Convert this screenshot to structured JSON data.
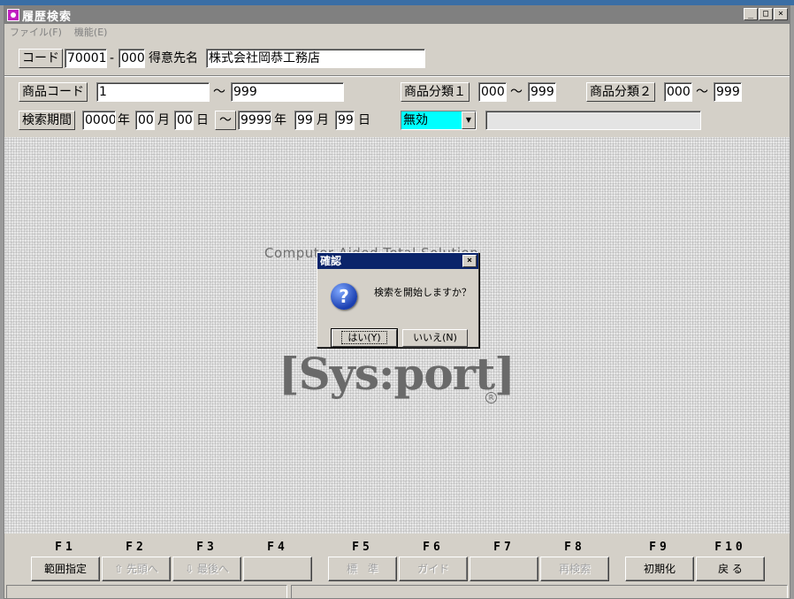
{
  "window": {
    "title": "履歴検索",
    "min_label": "_",
    "max_label": "□",
    "close_label": "×"
  },
  "menu": [
    {
      "label": "ファイル(F)"
    },
    {
      "label": "機能(E)"
    }
  ],
  "row1": {
    "code_label": "コード",
    "code_value": "70001",
    "dash": "-",
    "branch_value": "000",
    "customer_label": "得意先名",
    "customer_value": "株式会社岡恭工務店"
  },
  "row2": {
    "product_code_label": "商品コード",
    "product_code_from": "1",
    "tilde": "～",
    "product_code_to": "999",
    "category1_label": "商品分類１",
    "category1_from": "000",
    "category1_to": "999",
    "category2_label": "商品分類２",
    "category2_from": "000",
    "category2_to": "999"
  },
  "row3": {
    "period_label": "検索期間",
    "from_year": "0000",
    "year_unit": "年",
    "from_month": "00",
    "month_unit": "月",
    "from_day": "00",
    "day_unit": "日",
    "tilde_button": "～",
    "to_year": "9999",
    "to_month": "99",
    "to_day": "99",
    "validity_value": "無効",
    "dropdown_arrow": "▼",
    "extra_value": ""
  },
  "logo": {
    "subtitle": "Computer Aided Total Solution",
    "name": "[Sys:port]",
    "reg": "R"
  },
  "dialog": {
    "title": "確認",
    "close": "×",
    "icon": "?",
    "message": "検索を開始しますか？",
    "yes": "はい(Y)",
    "no": "いいえ(N)"
  },
  "fkeys": [
    {
      "key": "F1",
      "label": "範囲指定",
      "enabled": true
    },
    {
      "key": "F2",
      "label": "⇧ 先頭へ",
      "enabled": false
    },
    {
      "key": "F3",
      "label": "⇩ 最後へ",
      "enabled": false
    },
    {
      "key": "F4",
      "label": "",
      "enabled": false
    },
    {
      "key": "F5",
      "label": "標　準",
      "enabled": false
    },
    {
      "key": "F6",
      "label": "ガイド",
      "enabled": false
    },
    {
      "key": "F7",
      "label": "",
      "enabled": false
    },
    {
      "key": "F8",
      "label": "再検索",
      "enabled": false
    },
    {
      "key": "F9",
      "label": "初期化",
      "enabled": true
    },
    {
      "key": "F10",
      "label": "戻 る",
      "enabled": true
    }
  ],
  "colors": {
    "titlebar": "#808080",
    "dialog_titlebar": "#0a246a",
    "dropdown_bg": "#00ffff",
    "face": "#d4d0c8"
  }
}
